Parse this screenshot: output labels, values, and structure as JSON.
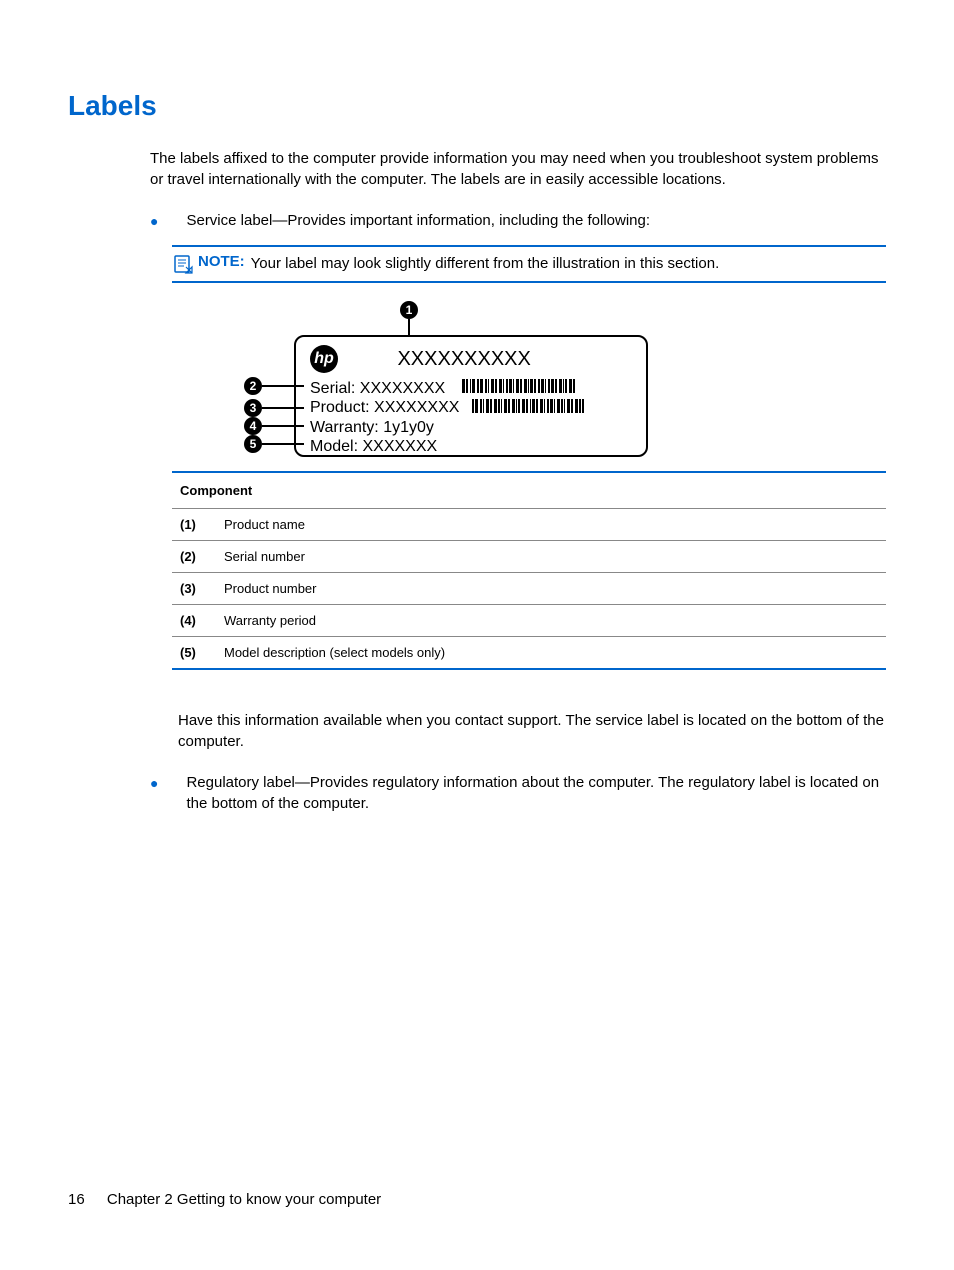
{
  "title": "Labels",
  "intro": "The labels affixed to the computer provide information you may need when you troubleshoot system problems or travel internationally with the computer. The labels are in easily accessible locations.",
  "bullets": [
    "Service label—Provides important information, including the following:",
    "Regulatory label—Provides regulatory information about the computer. The regulatory label is located on the bottom of the computer."
  ],
  "note": {
    "label": "NOTE:",
    "text": "Your label may look slightly different from the illustration in this section."
  },
  "diagram": {
    "hp_logo": "hp",
    "product_name": "XXXXXXXXXX",
    "lines": [
      "Serial:  XXXXXXXX",
      "Product: XXXXXXXX",
      "Warranty: 1y1y0y",
      "Model: XXXXXXX"
    ],
    "callouts": [
      "1",
      "2",
      "3",
      "4",
      "5"
    ]
  },
  "table": {
    "header": "Component",
    "rows": [
      {
        "num": "(1)",
        "desc": "Product name"
      },
      {
        "num": "(2)",
        "desc": "Serial number"
      },
      {
        "num": "(3)",
        "desc": "Product number"
      },
      {
        "num": "(4)",
        "desc": "Warranty period"
      },
      {
        "num": "(5)",
        "desc": "Model description (select models only)"
      }
    ]
  },
  "after_text": "Have this information available when you contact support. The service label is located on the bottom of the computer.",
  "footer": {
    "page": "16",
    "chapter": "Chapter 2   Getting to know your computer"
  }
}
